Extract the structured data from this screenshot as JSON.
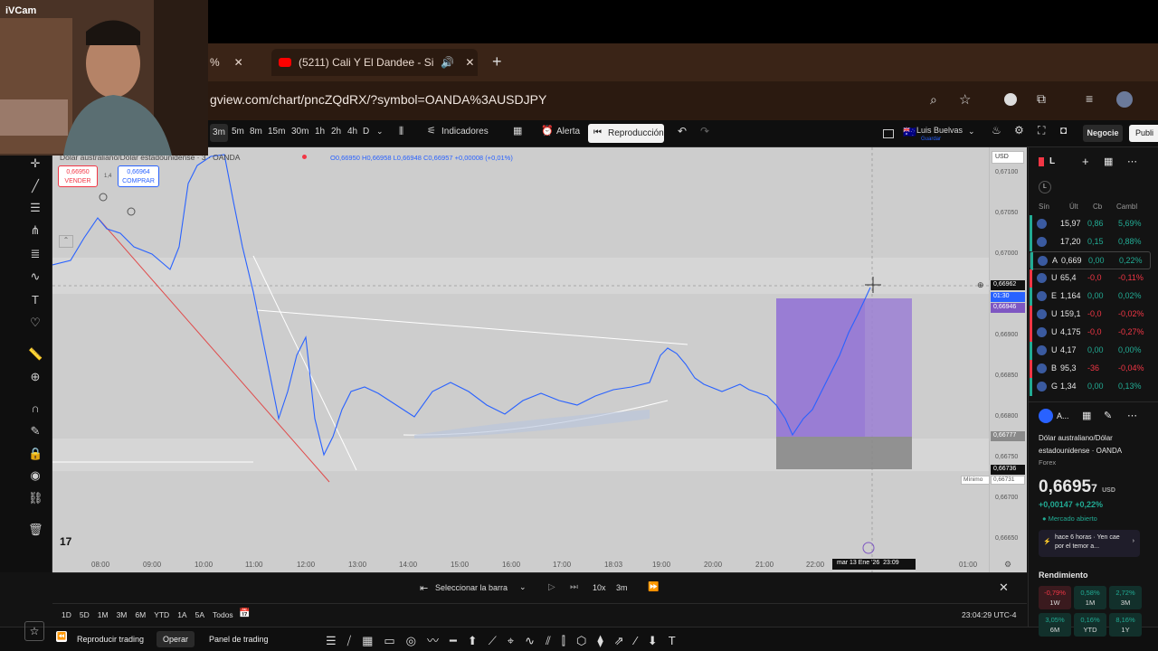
{
  "webcam": {
    "label": "iVCam"
  },
  "browser": {
    "tab1_label": "%",
    "tab2_label": "(5211) Cali Y El Dandee - Si",
    "new_tab": "+",
    "url": "gview.com/chart/pncZQdRX/?symbol=OANDA%3AUSDJPY"
  },
  "toolbar": {
    "intervals": [
      "3m",
      "5m",
      "8m",
      "15m",
      "30m",
      "1h",
      "2h",
      "4h",
      "D"
    ],
    "indicators": "Indicadores",
    "alert": "Alerta",
    "replay": "Reproducción",
    "user_name": "Luis Buelvas",
    "user_sub": "Guardar",
    "trade": "Negocie",
    "publish": "Publi"
  },
  "chart": {
    "symbol_title": "Dólar australiano/Dólar estadounidense · 3 · OANDA",
    "ohlc": "O0,66950  H0,66958  L0,66948  C0,66957  +0,00008 (+0,01%)",
    "sell_price": "0,66950",
    "sell_label": "VENDER",
    "spread": "1,4",
    "buy_price": "0,66964",
    "buy_label": "COMPRAR",
    "currency": "USD",
    "price_labels": [
      "0,67100",
      "0,67050",
      "0,67000",
      "0,66900",
      "0,66850",
      "0,66800",
      "0,66750",
      "0,66700",
      "0,66650"
    ],
    "current_price": "0,66962",
    "countdown": "01:30",
    "bid_tag": "0,66946",
    "tag_a": "0,66777",
    "tag_b": "0,66736",
    "minimo_label": "Mínimo",
    "minimo_value": "0,66731",
    "time_labels": [
      "08:00",
      "09:00",
      "10:00",
      "11:00",
      "12:00",
      "13:00",
      "14:00",
      "15:00",
      "16:00",
      "17:00",
      "18:03",
      "19:00",
      "20:00",
      "21:00",
      "22:00",
      "01:00"
    ],
    "cursor_date": "mar 13 Ene '26",
    "cursor_time": "23:09",
    "logo": "17"
  },
  "replay_bar": {
    "select_bar": "Seleccionar la barra",
    "speed": "10x",
    "interval": "3m"
  },
  "periods": [
    "1D",
    "5D",
    "1M",
    "3M",
    "6M",
    "YTD",
    "1A",
    "5A",
    "Todos"
  ],
  "clock": "23:04:29 UTC-4",
  "bottom": {
    "replay_trading": "Reproducir trading",
    "operate": "Operar",
    "panel": "Panel de trading"
  },
  "watchlist": {
    "title": "L",
    "headers": [
      "Sín",
      "Últ",
      "Cb",
      "Cambl"
    ],
    "rows": [
      {
        "sym": "",
        "last": "15,97",
        "chg": "0,86",
        "pct": "5,69%",
        "dir": "green"
      },
      {
        "sym": "",
        "last": "17,20",
        "chg": "0,15",
        "pct": "0,88%",
        "dir": "green"
      },
      {
        "sym": "A",
        "last": "0,669",
        "chg": "0,00",
        "pct": "0,22%",
        "dir": "green"
      },
      {
        "sym": "U",
        "last": "65,4",
        "chg": "-0,0",
        "pct": "-0,11%",
        "dir": "red"
      },
      {
        "sym": "E",
        "last": "1,164",
        "chg": "0,00",
        "pct": "0,02%",
        "dir": "green"
      },
      {
        "sym": "U",
        "last": "159,1",
        "chg": "-0,0",
        "pct": "-0,02%",
        "dir": "red"
      },
      {
        "sym": "U",
        "last": "4,175",
        "chg": "-0,0",
        "pct": "-0,27%",
        "dir": "red"
      },
      {
        "sym": "U",
        "last": "4,17",
        "chg": "0,00",
        "pct": "0,00%",
        "dir": "green"
      },
      {
        "sym": "B",
        "last": "95,3",
        "chg": "-36",
        "pct": "-0,04%",
        "dir": "red"
      },
      {
        "sym": "G",
        "last": "1,34",
        "chg": "0,00",
        "pct": "0,13%",
        "dir": "green"
      }
    ]
  },
  "detail": {
    "sym": "A...",
    "name": "Dólar australiano/Dólar estadounidense",
    "exchange": "OANDA",
    "type": "Forex",
    "price": "0,6695",
    "price_small": "7",
    "price_unit": "USD",
    "change": "+0,00147  +0,22%",
    "status": "Mercado abierto",
    "news": "hace 6 horas · Yen cae por el temor a...",
    "perf_title": "Rendimiento",
    "perf": [
      {
        "v": "-0,79%",
        "p": "1W",
        "dir": "red"
      },
      {
        "v": "0,58%",
        "p": "1M",
        "dir": "green"
      },
      {
        "v": "2,72%",
        "p": "3M",
        "dir": "green"
      },
      {
        "v": "3,05%",
        "p": "6M",
        "dir": "green"
      },
      {
        "v": "0,16%",
        "p": "YTD",
        "dir": "green"
      },
      {
        "v": "8,16%",
        "p": "1Y",
        "dir": "green"
      }
    ]
  }
}
